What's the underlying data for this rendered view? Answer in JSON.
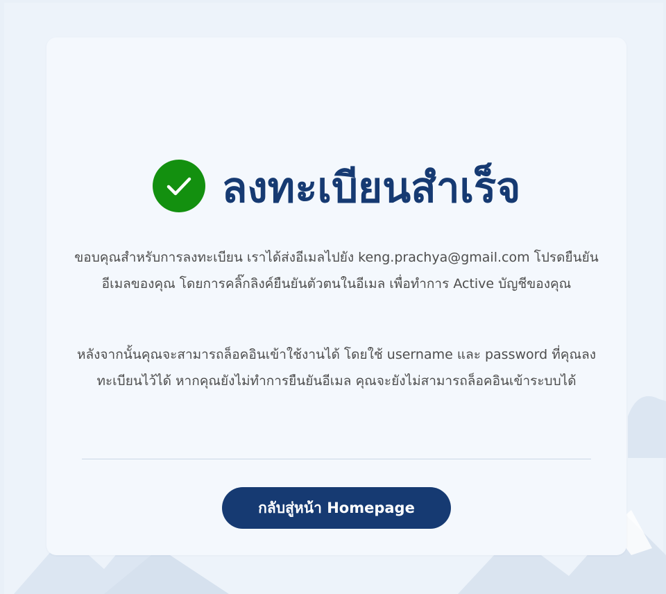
{
  "title": "ลงทะเบียนสำเร็จ",
  "message1": "ขอบคุณสำหรับการลงทะเบียน เราได้ส่งอีเมลไปยัง keng.prachya@gmail.com โปรดยืนยันอีเมลของคุณ โดยการคลิ๊กลิงค์ยืนยันตัวตนในอีเมล เพื่อทำการ Active บัญชีของคุณ",
  "message2": "หลังจากนั้นคุณจะสามารถล็อคอินเข้าใช้งานได้ โดยใช้ username และ password ที่คุณลงทะเบียนไว้ได้ หากคุณยังไม่ทำการยืนยันอีเมล คุณจะยังไม่สามารถล็อคอินเข้าระบบได้",
  "button_label": "กลับสู่หน้า Homepage",
  "icons": {
    "success": "check-circle-icon"
  },
  "colors": {
    "primary": "#163a72",
    "success": "#13900f",
    "text": "#4d4d4d",
    "card": "#f4f8fd",
    "background": "#e9f0f8"
  }
}
